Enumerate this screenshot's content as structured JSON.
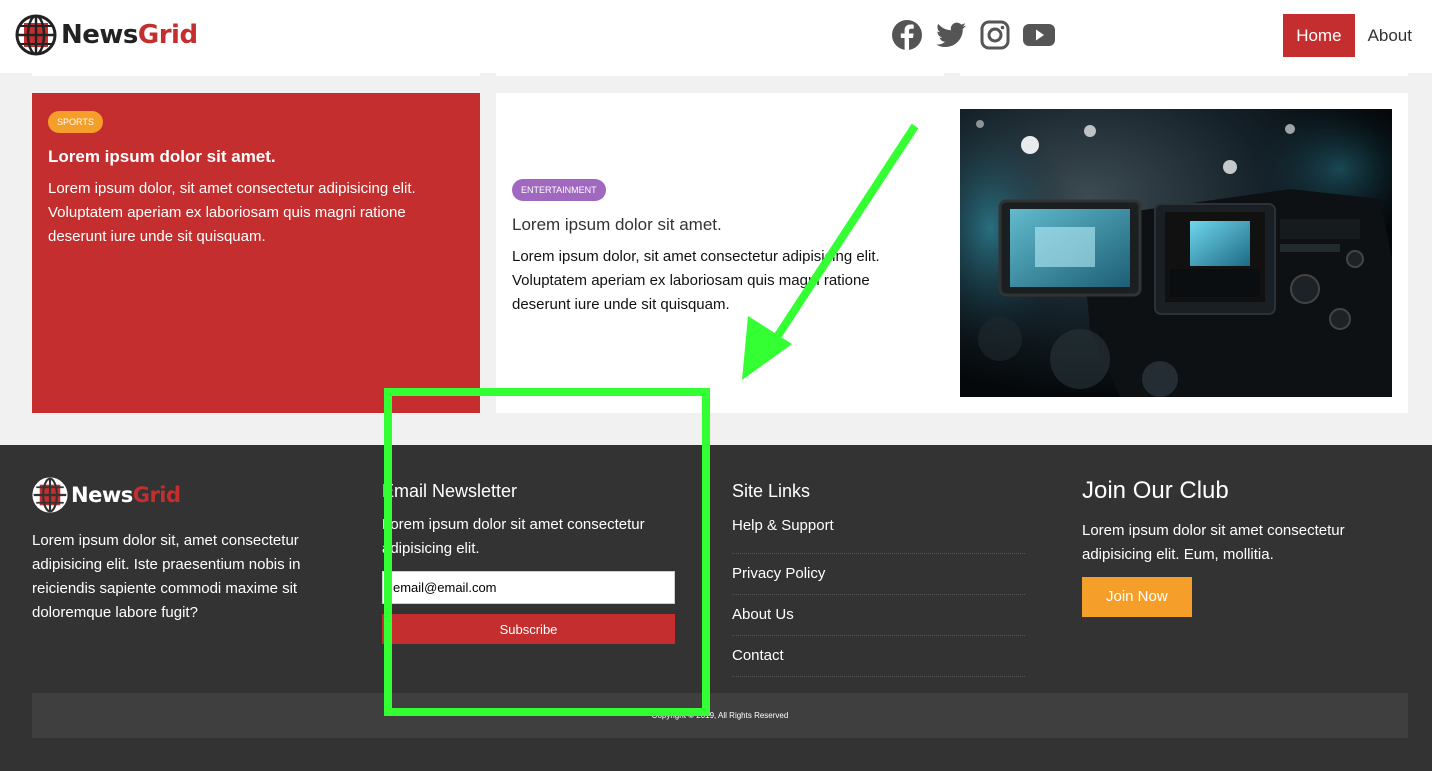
{
  "header": {
    "brand_news": "News",
    "brand_grid": "Grid",
    "social": [
      "facebook-icon",
      "twitter-icon",
      "instagram-icon",
      "youtube-icon"
    ],
    "nav": {
      "home": "Home",
      "about": "About"
    }
  },
  "cards": {
    "sports": {
      "badge": "SPORTS",
      "title": "Lorem ipsum dolor sit amet.",
      "body": "Lorem ipsum dolor, sit amet consectetur adipisicing elit. Voluptatem aperiam ex laboriosam quis magni ratione deserunt iure unde sit quisquam."
    },
    "entertainment": {
      "badge": "ENTERTAINMENT",
      "title": "Lorem ipsum dolor sit amet.",
      "body": "Lorem ipsum dolor, sit amet consectetur adipisicing elit. Voluptatem aperiam ex laboriosam quis magni ratione deserunt iure unde sit quisquam."
    }
  },
  "footer": {
    "about": {
      "brand_news": "News",
      "brand_grid": "Grid",
      "text": "Lorem ipsum dolor sit, amet consectetur adipisicing elit. Iste praesentium nobis in reiciendis sapiente commodi maxime sit doloremque labore fugit?"
    },
    "newsletter": {
      "title": "Email Newsletter",
      "text": "Lorem ipsum dolor sit amet consectetur adipisicing elit.",
      "email_value": "email@email.com",
      "button": "Subscribe"
    },
    "links": {
      "title": "Site Links",
      "items": [
        "Help & Support",
        "Privacy Policy",
        "About Us",
        "Contact"
      ]
    },
    "club": {
      "title": "Join Our Club",
      "text": "Lorem ipsum dolor sit amet consectetur adipisicing elit. Eum, mollitia.",
      "button": "Join Now"
    },
    "copyright": "Copyright © 2019, All Rights Reserved"
  },
  "colors": {
    "brand_red": "#c42e2e",
    "accent_orange": "#f59f2a",
    "entertainment_purple": "#a068bf",
    "footer_bg": "#333333",
    "annotation_green": "#33ff33"
  }
}
